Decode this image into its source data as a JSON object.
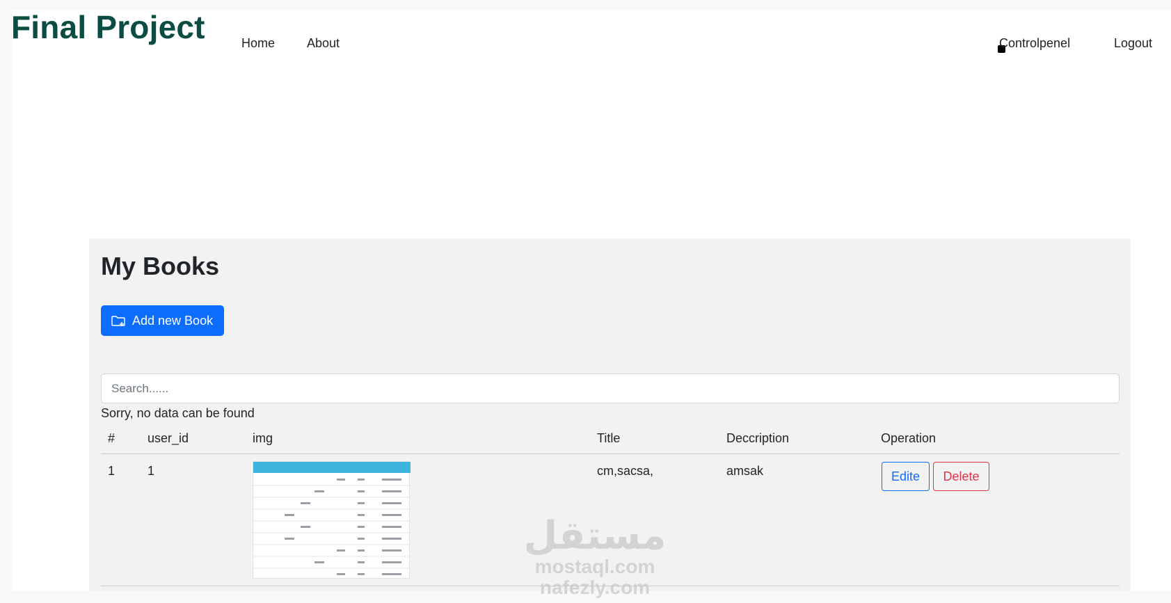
{
  "header": {
    "brand": "Final Project",
    "nav": {
      "home": "Home",
      "about": "About",
      "controlpanel": "Controlpenel",
      "logout": "Logout"
    }
  },
  "books": {
    "title": "My Books",
    "add_button": "Add new Book",
    "search_placeholder": "Search......",
    "empty_message": "Sorry, no data can be found",
    "columns": [
      "#",
      "user_id",
      "img",
      "Title",
      "Deccription",
      "Operation"
    ],
    "rows": [
      {
        "num": "1",
        "user_id": "1",
        "img": "table-screenshot-thumbnail",
        "title": "cm,sacsa,",
        "description": "amsak",
        "edit_label": "Edite",
        "delete_label": "Delete"
      }
    ]
  },
  "watermark": {
    "arabic": "مستقل",
    "line1": "mostaql.com",
    "line2": "nafezly.com"
  },
  "colors": {
    "brand": "#0b4d43",
    "primary": "#0d6efd",
    "danger": "#dc3545",
    "panel": "#f2f2f2"
  },
  "icons": {
    "add_button": "folder-plus-icon",
    "nav_bullet": "square-bullet-icon"
  }
}
